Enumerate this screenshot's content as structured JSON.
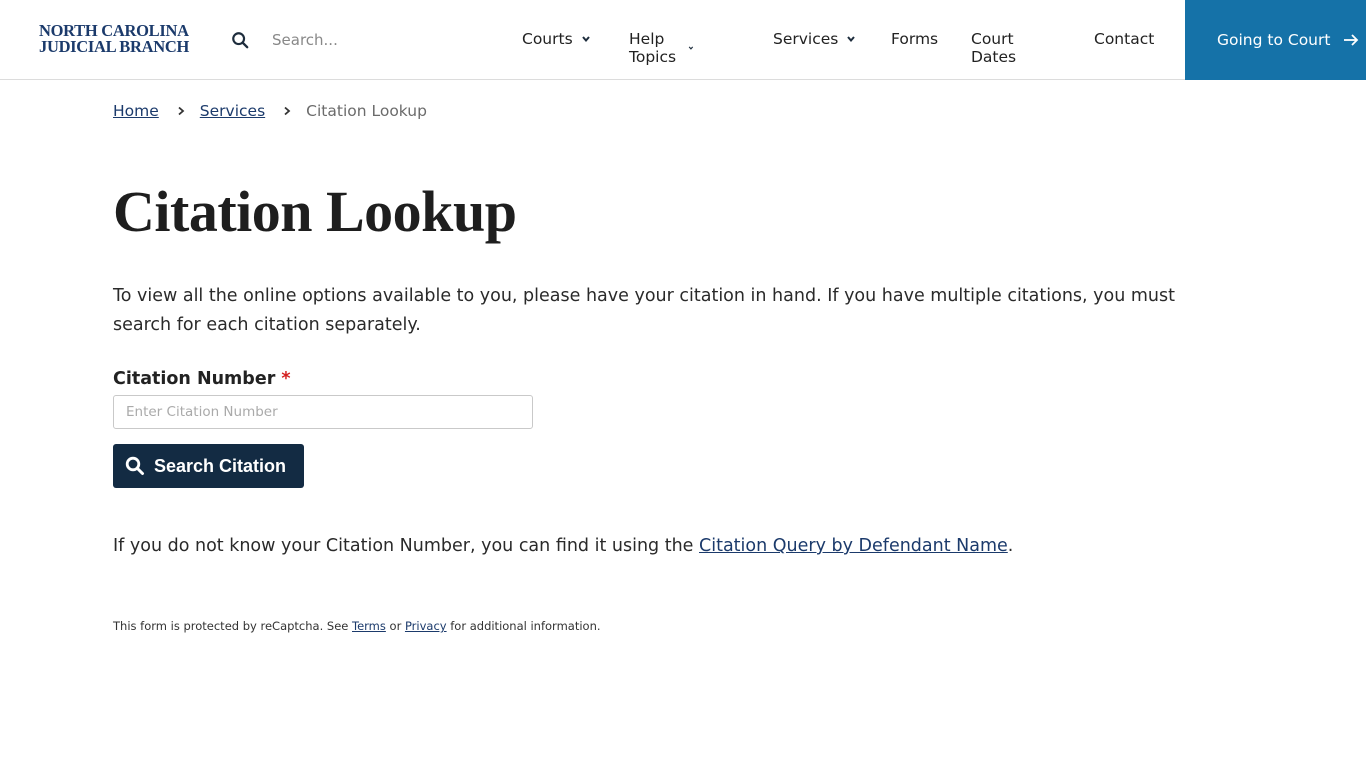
{
  "header": {
    "logo_line1": "NORTH CAROLINA",
    "logo_line2": "JUDICIAL BRANCH",
    "search_placeholder": "Search...",
    "nav": [
      {
        "label": "Courts",
        "has_dropdown": true
      },
      {
        "label": "Help Topics",
        "has_dropdown": true
      },
      {
        "label": "Services",
        "has_dropdown": true
      },
      {
        "label": "Forms",
        "has_dropdown": false
      },
      {
        "label": "Court Dates",
        "has_dropdown": false
      },
      {
        "label": "Contact",
        "has_dropdown": false
      }
    ],
    "cta_label": "Going to Court",
    "cta_icon": "arrow-right-icon",
    "cta_color": "#1572a8"
  },
  "breadcrumb": {
    "items": [
      {
        "label": "Home",
        "link": true
      },
      {
        "label": "Services",
        "link": true
      },
      {
        "label": "Citation Lookup",
        "link": false
      }
    ]
  },
  "main": {
    "title": "Citation Lookup",
    "intro": "To view all the online options available to you, please have your citation in hand. If you have multiple citations, you must search for each citation separately.",
    "field_label": "Citation Number",
    "required_mark": "*",
    "input_placeholder": "Enter Citation Number",
    "input_value": "",
    "search_button": "Search Citation",
    "button_color": "#132b43",
    "help_prefix": "If you do not know your Citation Number, you can find it using the ",
    "help_link": "Citation Query by Defendant Name",
    "help_suffix": ".",
    "captcha_prefix": "This form is protected by reCaptcha. See ",
    "captcha_terms": "Terms",
    "captcha_or": " or ",
    "captcha_privacy": "Privacy",
    "captcha_suffix": " for additional information."
  }
}
